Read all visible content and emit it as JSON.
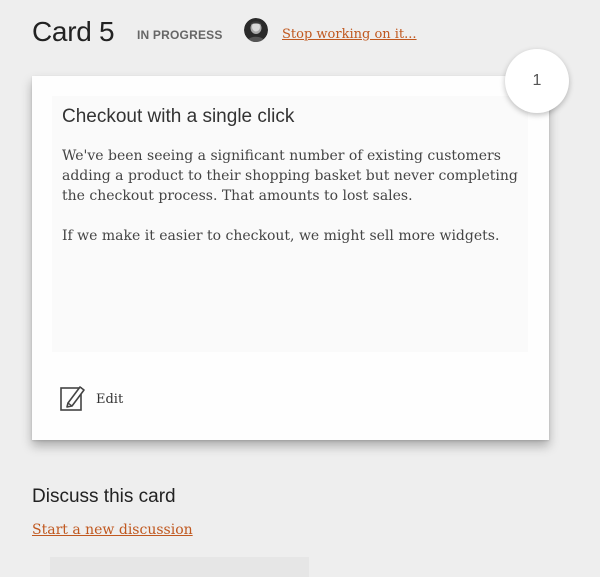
{
  "header": {
    "card_number": "Card 5",
    "status": "IN PROGRESS",
    "stop_link": "Stop working on it..."
  },
  "card": {
    "title": "Checkout with a single click",
    "description": [
      "We've been seeing a significant number of existing customers adding a product to their shopping basket but never completing the checkout process. That amounts to lost sales.",
      "If we make it easier to checkout, we might sell more widgets."
    ],
    "edit_label": "Edit",
    "vote_count": "1"
  },
  "discussion": {
    "title": "Discuss this card",
    "new_link": "Start a new discussion"
  },
  "colors": {
    "link": "#c0581f",
    "background": "#eeeeee",
    "card": "#fefefe"
  },
  "icons": {
    "avatar": "user-avatar",
    "edit": "pencil-edit-icon"
  }
}
